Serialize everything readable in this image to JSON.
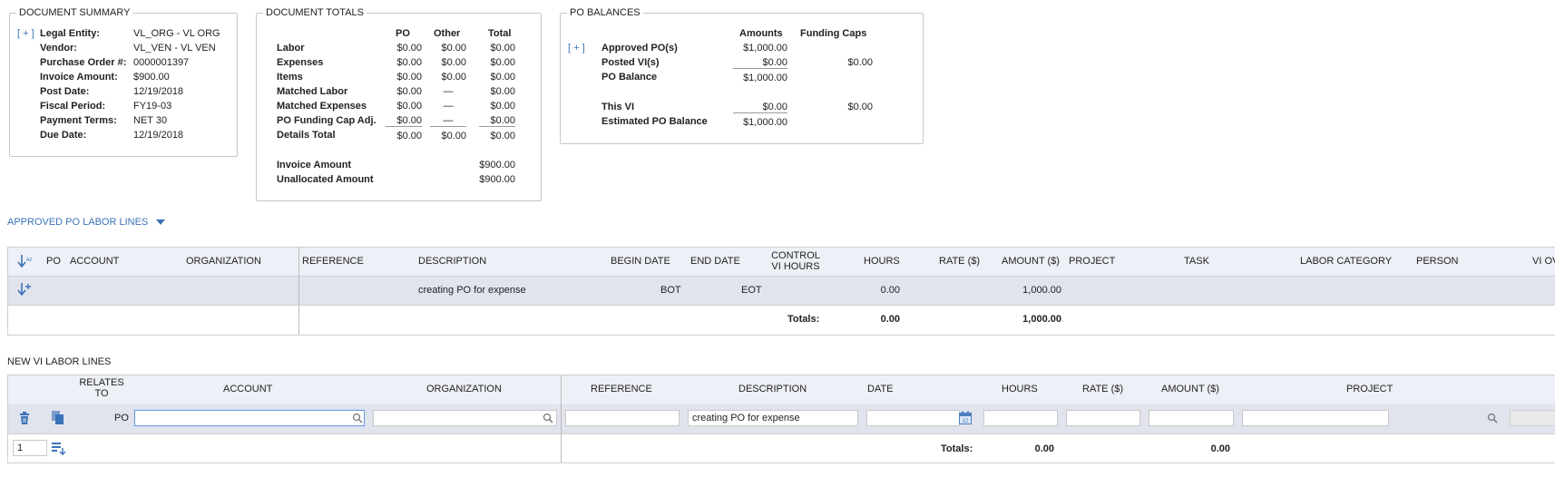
{
  "summary": {
    "legend": "DOCUMENT SUMMARY",
    "expand": "[ + ]",
    "rows": [
      {
        "label": "Legal Entity:",
        "value": "VL_ORG - VL ORG"
      },
      {
        "label": "Vendor:",
        "value": "VL_VEN - VL VEN"
      },
      {
        "label": "Purchase Order #:",
        "value": "0000001397"
      },
      {
        "label": "Invoice Amount:",
        "value": "$900.00"
      },
      {
        "label": "Post Date:",
        "value": "12/19/2018"
      },
      {
        "label": "Fiscal Period:",
        "value": "FY19-03"
      },
      {
        "label": "Payment Terms:",
        "value": "NET 30"
      },
      {
        "label": "Due Date:",
        "value": "12/19/2018"
      }
    ]
  },
  "totals": {
    "legend": "DOCUMENT TOTALS",
    "headers": [
      "PO",
      "Other",
      "Total"
    ],
    "rows": [
      {
        "label": "Labor",
        "po": "$0.00",
        "other": "$0.00",
        "total": "$0.00"
      },
      {
        "label": "Expenses",
        "po": "$0.00",
        "other": "$0.00",
        "total": "$0.00"
      },
      {
        "label": "Items",
        "po": "$0.00",
        "other": "$0.00",
        "total": "$0.00"
      },
      {
        "label": "Matched Labor",
        "po": "$0.00",
        "other": "—",
        "total": "$0.00"
      },
      {
        "label": "Matched Expenses",
        "po": "$0.00",
        "other": "—",
        "total": "$0.00"
      },
      {
        "label": "PO Funding Cap Adj.",
        "po": "$0.00",
        "other": "—",
        "total": "$0.00"
      },
      {
        "label": "Details Total",
        "po": "$0.00",
        "other": "$0.00",
        "total": "$0.00"
      }
    ],
    "invoice_label": "Invoice Amount",
    "invoice_value": "$900.00",
    "unalloc_label": "Unallocated Amount",
    "unalloc_value": "$900.00"
  },
  "balances": {
    "legend": "PO BALANCES",
    "expand": "[ + ]",
    "headers": [
      "Amounts",
      "Funding Caps"
    ],
    "rows": [
      {
        "label": "Approved PO(s)",
        "amount": "$1,000.00",
        "cap": ""
      },
      {
        "label": "Posted VI(s)",
        "amount": "$0.00",
        "cap": "$0.00"
      },
      {
        "label": "PO Balance",
        "amount": "$1,000.00",
        "cap": ""
      },
      {
        "label": "This VI",
        "amount": "$0.00",
        "cap": "$0.00"
      },
      {
        "label": "Estimated PO Balance",
        "amount": "$1,000.00",
        "cap": ""
      }
    ]
  },
  "approved": {
    "title": "APPROVED PO LABOR LINES",
    "headers": {
      "po": "PO",
      "account": "ACCOUNT",
      "organization": "ORGANIZATION",
      "reference": "REFERENCE",
      "description": "DESCRIPTION",
      "begin_date": "BEGIN DATE",
      "end_date": "END DATE",
      "control_1": "CONTROL",
      "control_2": "VI HOURS",
      "hours": "HOURS",
      "rate": "RATE ($)",
      "amount": "AMOUNT ($)",
      "project": "PROJECT",
      "task": "TASK",
      "labor_category": "LABOR CATEGORY",
      "person": "PERSON",
      "vi_ov": "VI OV"
    },
    "row": {
      "description": "creating PO for expense",
      "begin": "BOT",
      "end": "EOT",
      "hours": "0.00",
      "amount": "1,000.00"
    },
    "totals_label": "Totals:",
    "totals_hours": "0.00",
    "totals_amount": "1,000.00"
  },
  "newvi": {
    "title": "NEW VI LABOR LINES",
    "headers": {
      "relates_1": "RELATES",
      "relates_2": "TO",
      "account": "ACCOUNT",
      "organization": "ORGANIZATION",
      "reference": "REFERENCE",
      "description": "DESCRIPTION",
      "date": "DATE",
      "hours": "HOURS",
      "rate": "RATE ($)",
      "amount": "AMOUNT ($)",
      "project": "PROJECT"
    },
    "relates_value": "PO",
    "inputs": {
      "account": "",
      "organization": "",
      "reference": "",
      "description": "creating PO for expense",
      "date": "",
      "hours": "",
      "rate": "",
      "amount": "",
      "project": ""
    },
    "row_count": "1",
    "totals_label": "Totals:",
    "totals_hours": "0.00",
    "totals_amount": "0.00"
  }
}
